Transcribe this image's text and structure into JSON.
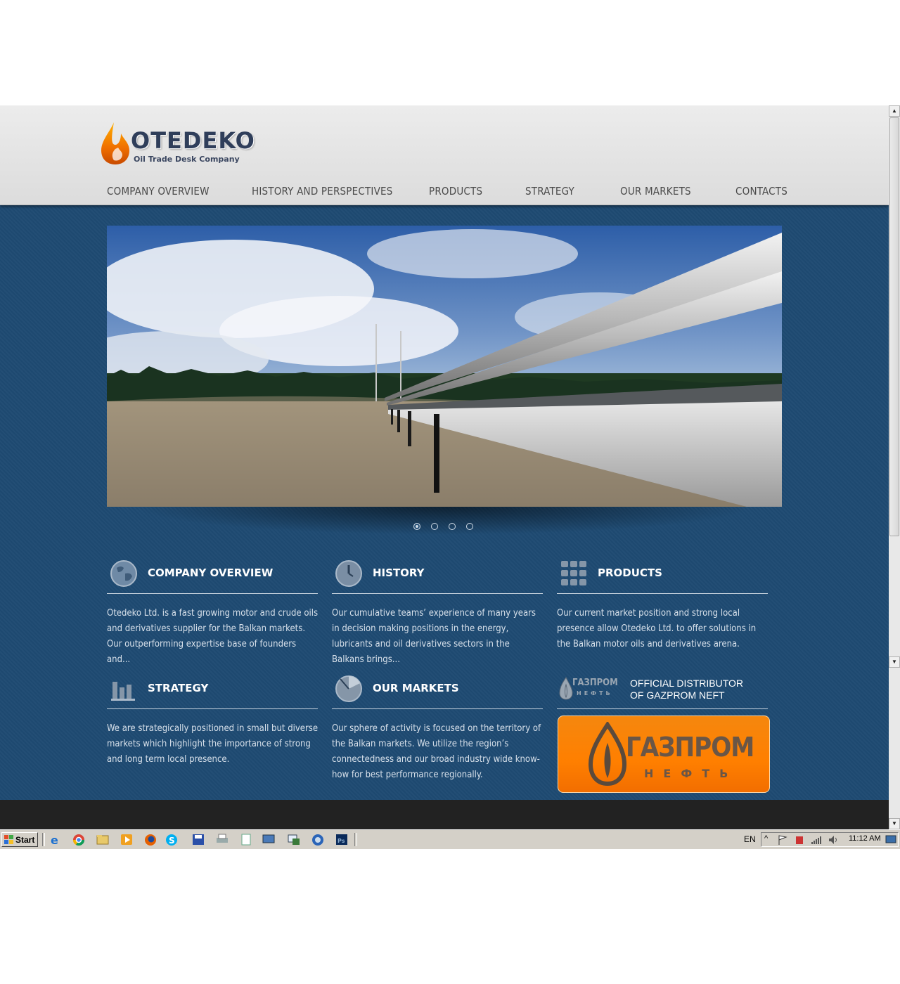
{
  "site": {
    "brand": {
      "name": "OTEDEKO",
      "tagline": "Oil Trade Desk Company"
    },
    "nav": [
      {
        "label": "COMPANY OVERVIEW"
      },
      {
        "label": "HISTORY AND PERSPECTIVES"
      },
      {
        "label": "PRODUCTS"
      },
      {
        "label": "STRATEGY"
      },
      {
        "label": "OUR MARKETS"
      },
      {
        "label": "CONTACTS"
      }
    ],
    "slider": {
      "slide_count": 4,
      "active_slide": 1
    },
    "blocks": {
      "overview": {
        "title": "COMPANY OVERVIEW",
        "icon": "globe-icon",
        "text": "Otedeko Ltd. is a fast growing motor and crude oils and derivatives supplier for the Balkan markets. Our outperforming expertise base of founders and..."
      },
      "history": {
        "title": "HISTORY",
        "icon": "clock-icon",
        "text": "Our cumulative teams’ experience of many years in decision making positions in the energy, lubricants and oil derivatives sectors in the Balkans brings..."
      },
      "products": {
        "title": "PRODUCTS",
        "icon": "grid-icon",
        "text": "Our current market position and strong local presence allow Otedeko Ltd. to offer solutions in the Balkan motor oils and derivatives arena."
      },
      "strategy": {
        "title": "STRATEGY",
        "icon": "bar-chart-icon",
        "text": "We are strategically positioned in small but diverse markets which highlight the importance of strong and long term local presence."
      },
      "markets": {
        "title": "OUR MARKETS",
        "icon": "pie-chart-icon",
        "text": "Our sphere of activity is focused on the territory of the Balkan markets. We utilize the region’s connectedness and our broad industry wide know-how for best performance regionally."
      },
      "gazprom": {
        "line1": "OFFICIAL DISTRIBUTOR",
        "line2": "OF GAZPROM NEFT",
        "logo_small": "ГАЗПРОМ",
        "logo_small_sub": "НЕФТЬ",
        "logo_big": "ГАЗПРОМ",
        "logo_big_sub": "НЕФТЬ"
      }
    }
  },
  "taskbar": {
    "start_label": "Start",
    "language": "EN",
    "clock": "11:12 AM",
    "apps": [
      "ie-icon",
      "chrome-icon",
      "explorer-icon",
      "media-player-icon",
      "firefox-icon",
      "skype-icon",
      "save-icon",
      "printer-icon",
      "notepad-icon",
      "network-icon",
      "window-icon",
      "browser-icon",
      "photoshop-icon"
    ]
  },
  "colors": {
    "page_bg": "#1e4a72",
    "header_bg": "#e4e4e4",
    "footer_bg": "#222222",
    "gazprom_orange": "#ff7f00"
  }
}
